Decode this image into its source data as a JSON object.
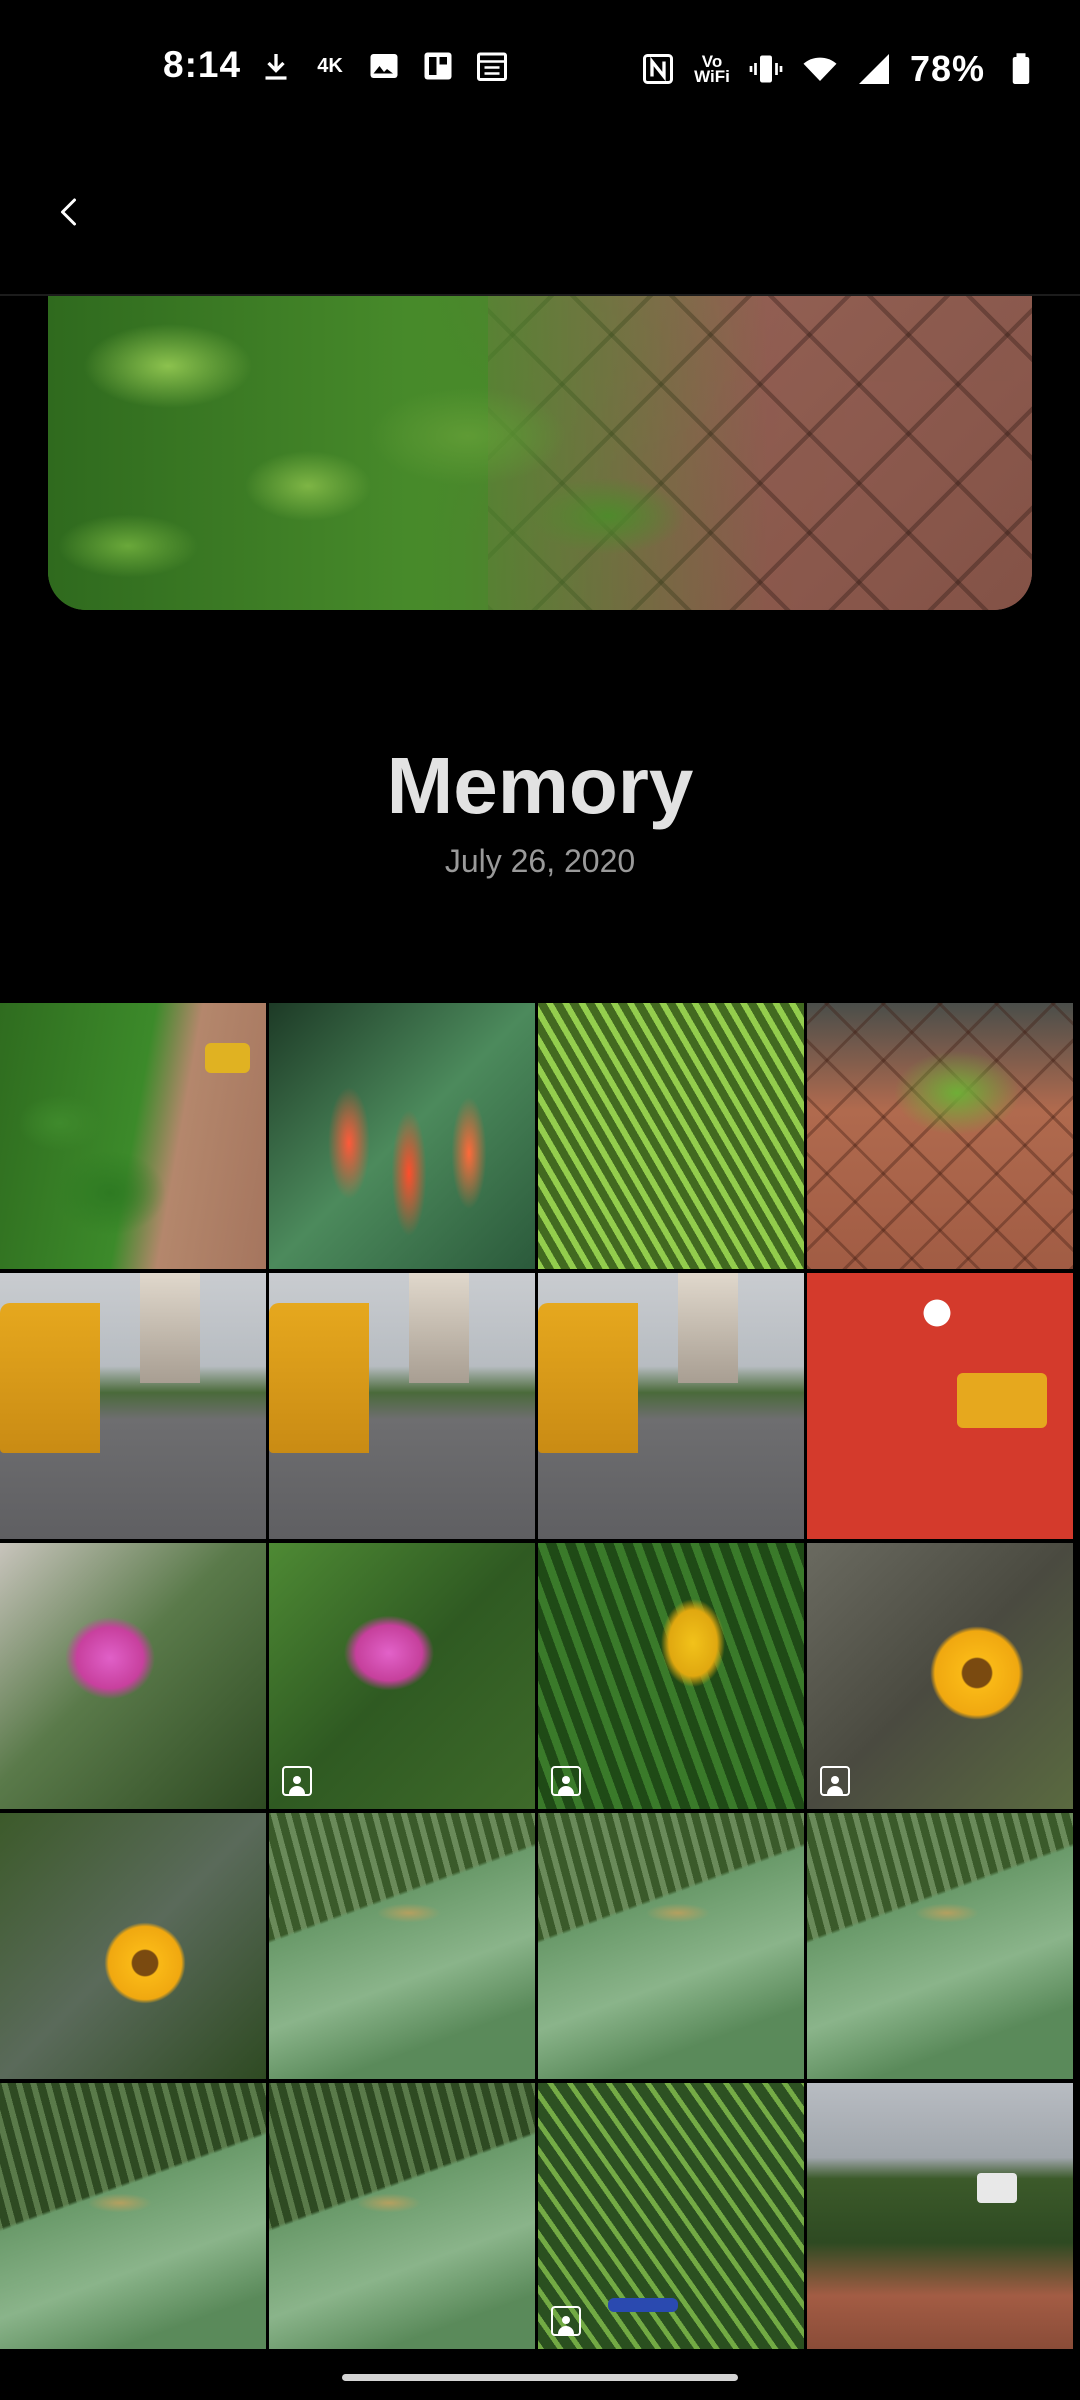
{
  "status_bar": {
    "time": "8:14",
    "left_icons": [
      "download-icon",
      "4k-wallpaper-icon",
      "image-icon",
      "flipboard-icon",
      "calendar-icon"
    ],
    "four_k_label": "4K",
    "volte_label_top": "Vo",
    "volte_label_bottom": "WiFi",
    "right_icons": [
      "nfc-icon",
      "vowifi-icon",
      "vibrate-icon",
      "wifi-icon",
      "cellular-signal-icon",
      "battery-icon"
    ],
    "battery_percent": "78%"
  },
  "app_bar": {
    "back_icon": "chevron-left-icon"
  },
  "memory": {
    "title": "Memory",
    "date": "July 26, 2020"
  },
  "photos": [
    {
      "scene": "garden",
      "portrait": false
    },
    {
      "scene": "firecracker",
      "portrait": false
    },
    {
      "scene": "fern",
      "portrait": false
    },
    {
      "scene": "fern-pavers",
      "portrait": false
    },
    {
      "scene": "bus-road",
      "portrait": false
    },
    {
      "scene": "bus-road",
      "portrait": false
    },
    {
      "scene": "bus-road",
      "portrait": false
    },
    {
      "scene": "road-sign",
      "portrait": false
    },
    {
      "scene": "pink-flower",
      "portrait": false
    },
    {
      "scene": "pink-flower-2",
      "portrait": true
    },
    {
      "scene": "yellow-bud",
      "portrait": true
    },
    {
      "scene": "daisy",
      "portrait": true
    },
    {
      "scene": "daisy-2",
      "portrait": false
    },
    {
      "scene": "dragonfly",
      "portrait": false
    },
    {
      "scene": "dragonfly",
      "portrait": false
    },
    {
      "scene": "dragonfly",
      "portrait": false
    },
    {
      "scene": "dragonfly-2",
      "portrait": false
    },
    {
      "scene": "dragonfly-2",
      "portrait": false
    },
    {
      "scene": "plant",
      "portrait": true
    },
    {
      "scene": "street-path",
      "portrait": false
    }
  ],
  "colors": {
    "background": "#000000",
    "title": "#e2e2e2",
    "subtitle": "#9a9a9a"
  }
}
